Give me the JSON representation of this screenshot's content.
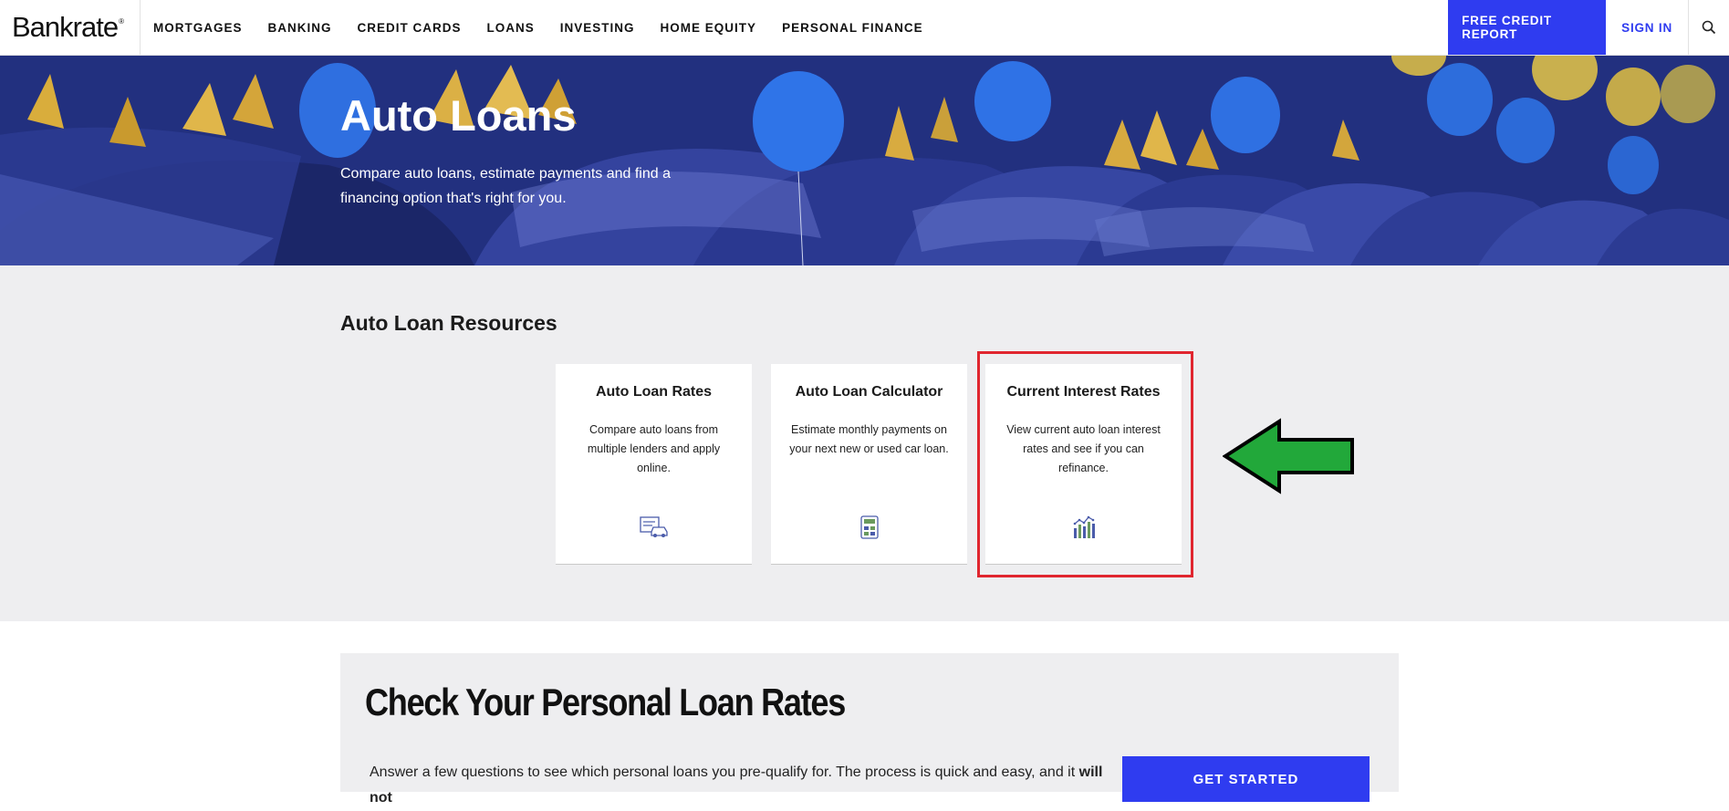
{
  "header": {
    "logo": "Bankrate",
    "logo_mark": "®",
    "nav": [
      "MORTGAGES",
      "BANKING",
      "CREDIT CARDS",
      "LOANS",
      "INVESTING",
      "HOME EQUITY",
      "PERSONAL FINANCE"
    ],
    "credit_report": "FREE CREDIT REPORT",
    "sign_in": "SIGN IN",
    "search_icon": "search-icon"
  },
  "hero": {
    "title": "Auto Loans",
    "subtitle": "Compare auto loans, estimate payments and find a financing option that's right for you."
  },
  "resources": {
    "title": "Auto Loan Resources",
    "cards": [
      {
        "title": "Auto Loan Rates",
        "desc": "Compare auto loans from multiple lenders and apply online.",
        "icon": "car-document-icon"
      },
      {
        "title": "Auto Loan Calculator",
        "desc": "Estimate monthly payments on your next new or used car loan.",
        "icon": "calculator-icon"
      },
      {
        "title": "Current Interest Rates",
        "desc": "View current auto loan interest rates and see if you can refinance.",
        "icon": "bar-chart-icon"
      }
    ]
  },
  "annotation": {
    "highlight_color": "#e0262f",
    "arrow_color": "#22a83a"
  },
  "bottom": {
    "title": "Check Your Personal Loan Rates",
    "text": "Answer a few questions to see which personal loans you pre-qualify for. The process is quick and easy, and it",
    "text_bold": "will not",
    "button": "GET STARTED"
  },
  "colors": {
    "brand_blue": "#2f3cf0",
    "section_gray": "#eeeef0"
  }
}
